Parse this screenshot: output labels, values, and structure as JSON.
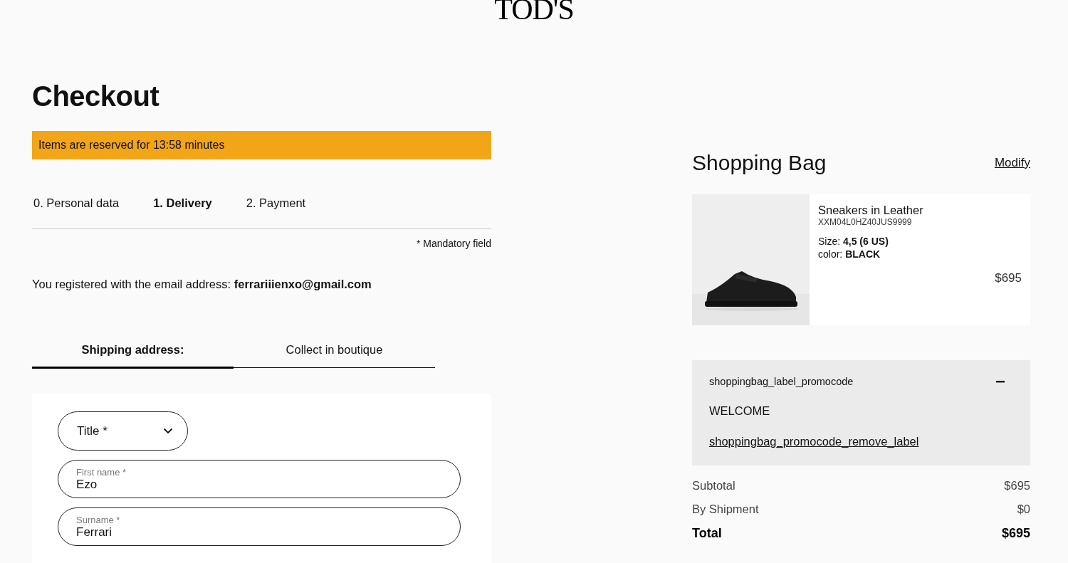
{
  "logo": "TOD'S",
  "title": "Checkout",
  "reservation_banner": "Items are reserved for 13:58 minutes",
  "steps": [
    {
      "label": "0. Personal data",
      "selected": false
    },
    {
      "label": "1. Delivery",
      "selected": true
    },
    {
      "label": "2. Payment",
      "selected": false
    }
  ],
  "mandatory_note": "* Mandatory field",
  "email_notice": "You registered with the email address: **ferrariiienxo@gmail.com**",
  "delivery_tabs": [
    {
      "label": "Shipping address:",
      "selected": true
    },
    {
      "label": "Collect in boutique",
      "selected": false
    }
  ],
  "form": {
    "title_select": {
      "placeholder": "Title *"
    },
    "fields": [
      {
        "label": "First name *",
        "value": "Ezo"
      },
      {
        "label": "Surname *",
        "value": "Ferrari"
      }
    ]
  },
  "bag": {
    "title": "Shopping Bag",
    "modify": "Modify",
    "item": {
      "name": "Sneakers in Leather",
      "code": "XXM04L0HZ40JUS9999",
      "size": "Size: **4,5 (6 US)**",
      "color_line": "color: **BLACK**",
      "price": "$695"
    },
    "promo": {
      "label": "shoppingbag_label_promocode",
      "expanded": true,
      "code": "WELCOME",
      "remove": "shoppingbag_promocode_remove_label"
    },
    "totals": [
      {
        "kind": "normal",
        "label": "Subtotal",
        "value": "$695"
      },
      {
        "kind": "normal",
        "label": "By Shipment",
        "value": "$0"
      },
      {
        "kind": "total",
        "label": "Total",
        "value": "$695"
      }
    ]
  }
}
